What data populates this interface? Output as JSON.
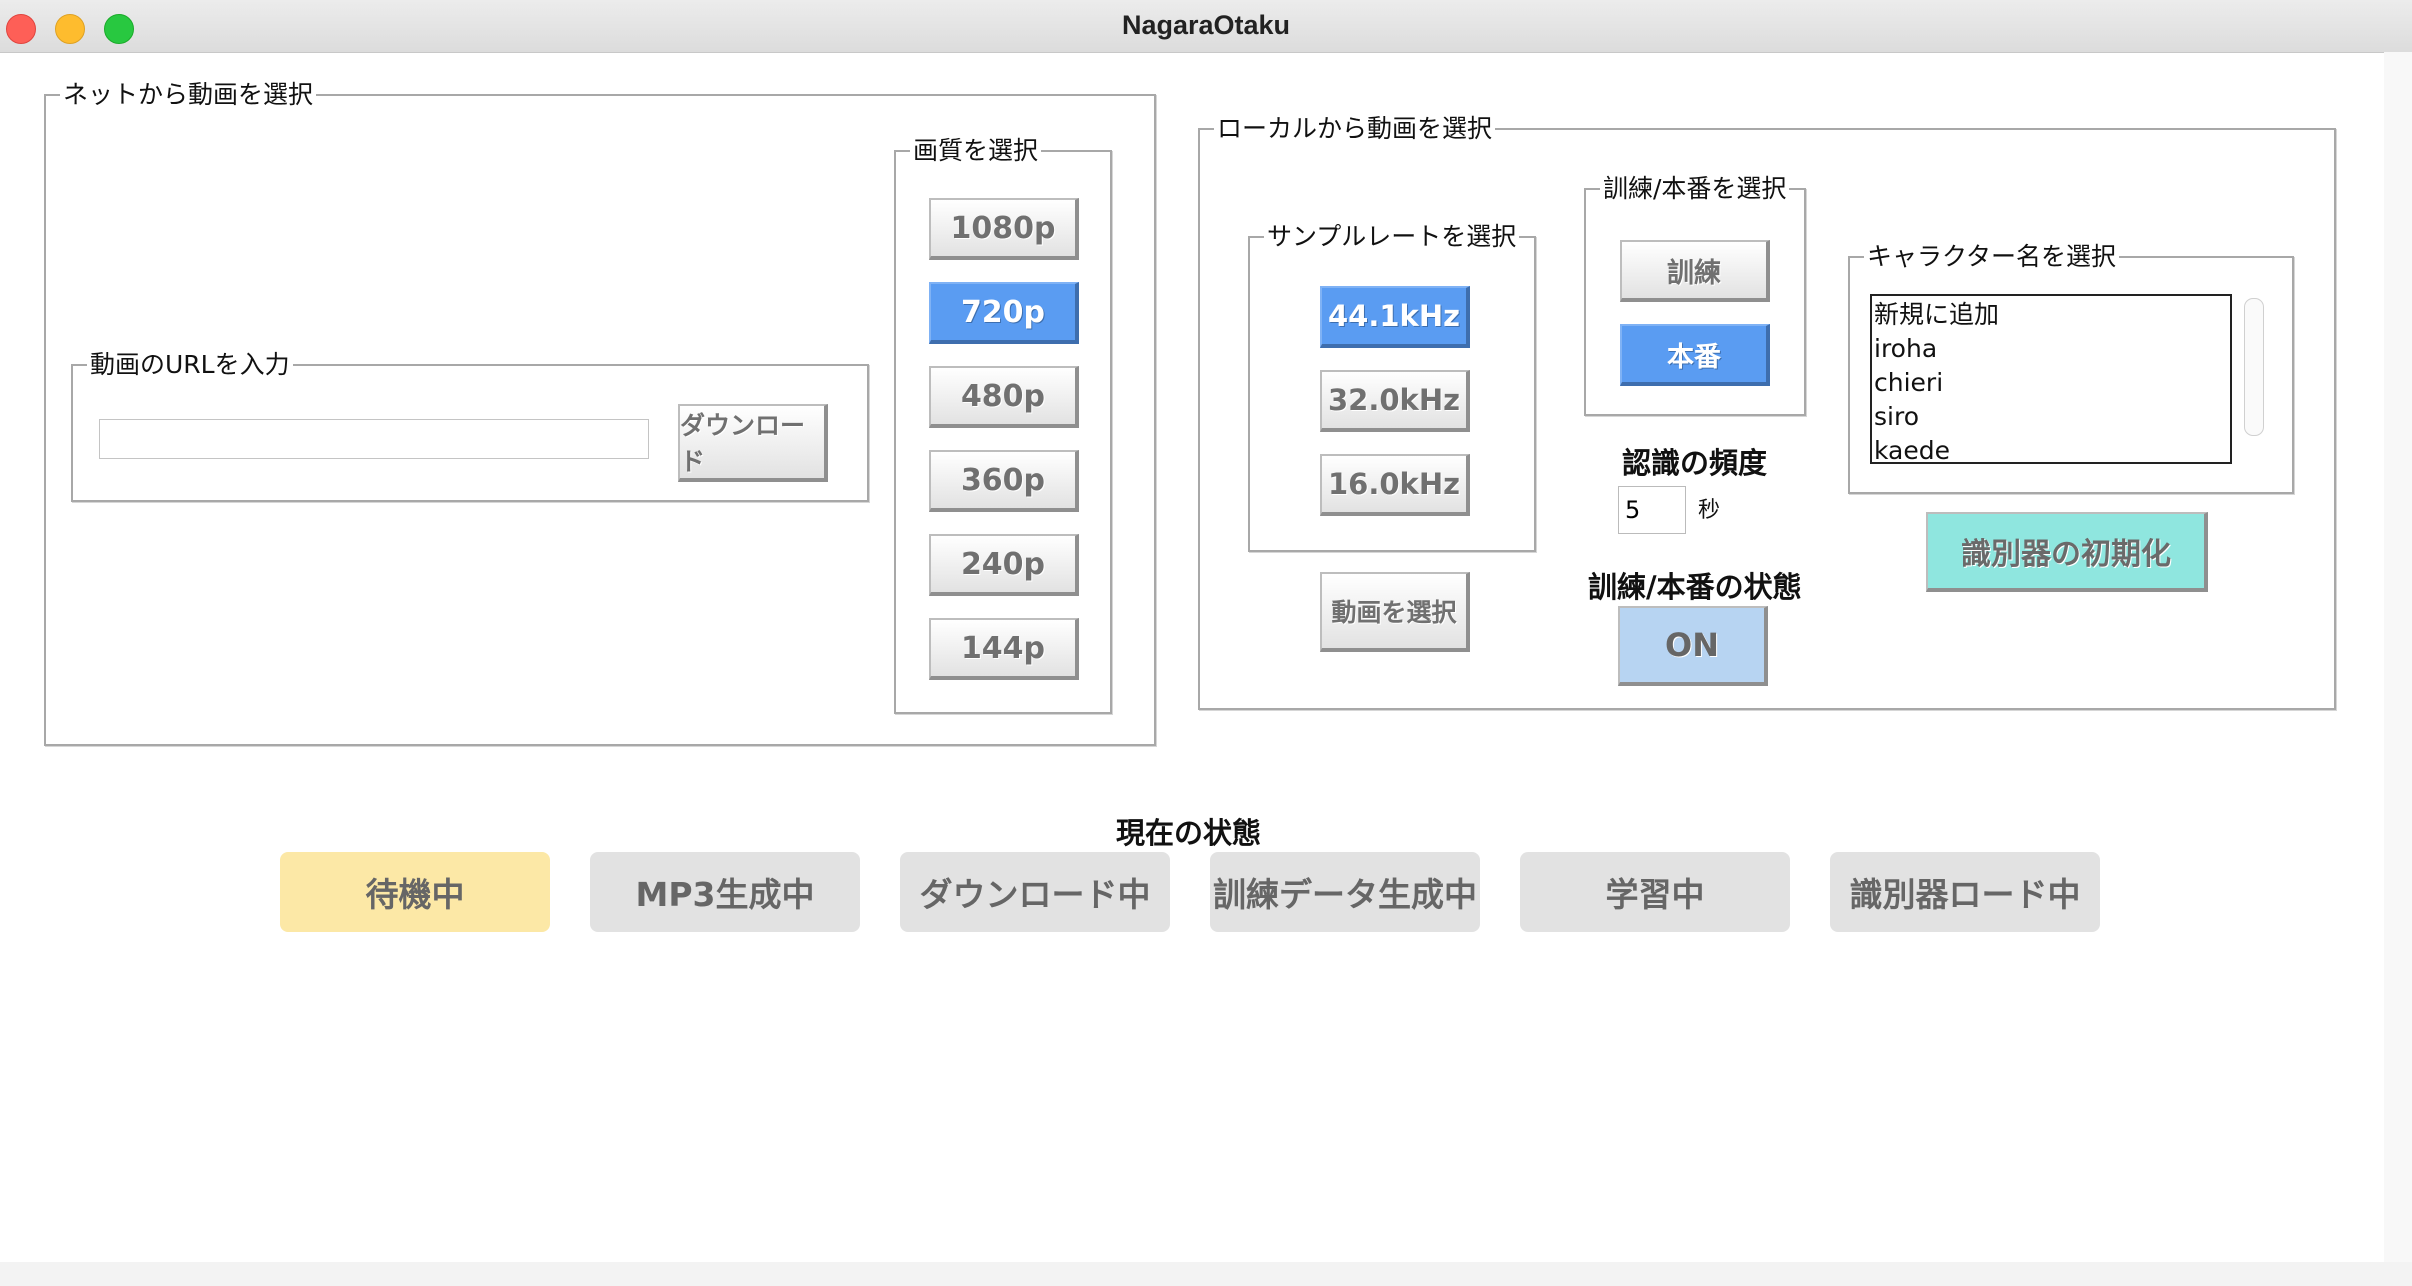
{
  "window": {
    "title": "NagaraOtaku"
  },
  "net": {
    "legend": "ネットから動画を選択",
    "url_group_legend": "動画のURLを入力",
    "url_value": "",
    "download_label": "ダウンロード",
    "quality_legend": "画質を選択",
    "qualities": [
      "1080p",
      "720p",
      "480p",
      "360p",
      "240p",
      "144p"
    ],
    "selected_quality": "720p"
  },
  "local": {
    "legend": "ローカルから動画を選択",
    "sample_rate_legend": "サンプルレートを選択",
    "sample_rates": [
      "44.1kHz",
      "32.0kHz",
      "16.0kHz"
    ],
    "selected_sample_rate": "44.1kHz",
    "select_video_label": "動画を選択",
    "mode_legend": "訓練/本番を選択",
    "modes": [
      "訓練",
      "本番"
    ],
    "selected_mode": "本番",
    "freq_title": "認識の頻度",
    "freq_value": "5",
    "freq_unit": "秒",
    "state_title": "訓練/本番の状態",
    "state_value": "ON",
    "character_legend": "キャラクター名を選択",
    "characters": [
      "新規に追加",
      "iroha",
      "chieri",
      "siro",
      "kaede"
    ],
    "init_label": "識別器の初期化"
  },
  "status": {
    "title": "現在の状態",
    "items": [
      "待機中",
      "MP3生成中",
      "ダウンロード中",
      "訓練データ生成中",
      "学習中",
      "識別器ロード中"
    ],
    "active": "待機中"
  },
  "colors": {
    "selected": "#5a9cf2",
    "state_on": "#b7d4f2",
    "init_button": "#8fe6df",
    "status_active": "#fce8a6",
    "status_idle": "#e2e2e2"
  }
}
